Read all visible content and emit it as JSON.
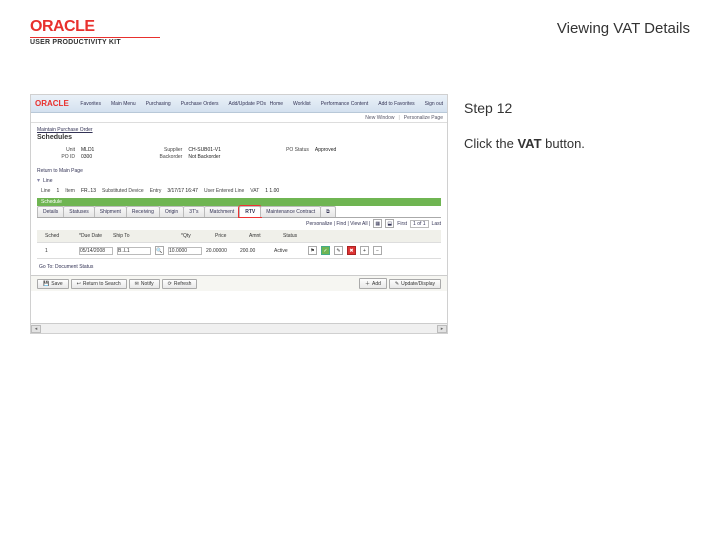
{
  "header": {
    "logo": "ORACLE",
    "logo_subtitle": "USER PRODUCTIVITY KIT",
    "title": "Viewing VAT Details"
  },
  "side": {
    "step": "Step 12",
    "instruction_prefix": "Click the ",
    "instruction_strong": "VAT",
    "instruction_suffix": " button."
  },
  "app": {
    "topbar": {
      "brand": "ORACLE",
      "menu": [
        "Favorites",
        "Main Menu",
        "Purchasing",
        "Purchase Orders",
        "Add/Update POs"
      ],
      "nav": [
        "Home",
        "Worklist",
        "Performance Content",
        "Add to Favorites",
        "Sign out"
      ]
    },
    "subbar": {
      "left": "New Window",
      "right": "Personalize Page"
    },
    "breadcrumb": "Maintain Purchase Order",
    "section": "Schedules",
    "fields": {
      "unit": {
        "label": "Unit",
        "value": "MLD1"
      },
      "po_id": {
        "label": "PO ID",
        "value": "0300"
      },
      "supplier": {
        "label": "Supplier",
        "value": "CH-SUB01-V1"
      },
      "backorder": {
        "label": "Backorder",
        "value": "Not Backorder"
      },
      "po_status": {
        "label": "PO Status",
        "value": "Approved"
      }
    },
    "section2": "Return to Main Page",
    "line_bar": "Line",
    "line": {
      "line_no": {
        "label": "Line",
        "value": "1"
      },
      "item": {
        "label": "Item",
        "value": "FR..13"
      },
      "desc": {
        "label": "Substituted Device",
        "value": ""
      },
      "entry": {
        "label": "Entry",
        "value": "3/17/17  16:47"
      },
      "user": {
        "label": "User Entered Line",
        "value": ""
      },
      "vat": {
        "label": "VAT",
        "value": "1      1.00"
      }
    },
    "green_bar": "Schedule",
    "tabs": [
      "Details",
      "Statuses",
      "Shipment",
      "Receiving",
      "Origin",
      "3T's",
      "Matchment",
      "RTV",
      "Maintenance Contract",
      "⧉"
    ],
    "personalize": {
      "text": "Personalize | Find | View All |",
      "first": "First",
      "pager": "1 of 1",
      "last": "Last"
    },
    "grid": {
      "headers": [
        "Sched",
        "*Due Date",
        "Ship To",
        "",
        "*Qty",
        "Price",
        "Amnt",
        "Status"
      ],
      "row": [
        "1",
        "05/14/2008",
        "B..L1",
        "📍",
        "10.0000",
        "20.00000",
        "200.00",
        "Active"
      ]
    },
    "goto": "Go To: Document Status",
    "footer": {
      "save": "Save",
      "return": "Return to Search",
      "notify": "Notify",
      "refresh": "Refresh",
      "add": "Add",
      "update": "Update/Display"
    }
  }
}
